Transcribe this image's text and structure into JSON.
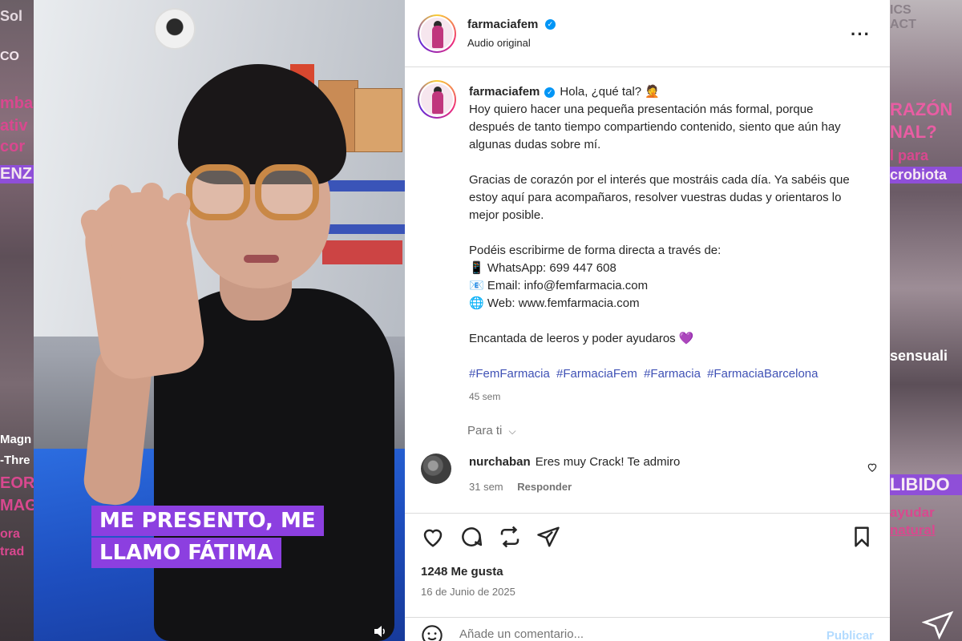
{
  "background": {
    "left_snippets": [
      "Sol",
      "CO",
      "mba",
      "ativ",
      "cor",
      "ENZ",
      "Magn",
      "-Thre",
      "EOR",
      "MAG",
      "ora",
      "trad"
    ],
    "right_snippets": [
      "ICS",
      "ACT",
      "RAZÓN",
      "NAL?",
      "l para",
      "crobiota",
      "sensuali",
      "LIBIDO",
      "ayudar",
      "natural"
    ]
  },
  "video": {
    "caption_line1": "ME PRESENTO, ME",
    "caption_line2": "LLAMO FÁTIMA",
    "caption_color": "#8c3fe0"
  },
  "header": {
    "username": "farmaciafem",
    "subtitle": "Audio original"
  },
  "post": {
    "username": "farmaciafem",
    "greeting": "Hola, ¿qué tal? 🤦",
    "paragraph1": "Hoy quiero hacer una pequeña presentación más formal, porque después de tanto tiempo compartiendo contenido, siento que aún hay algunas dudas sobre mí.",
    "paragraph2": "Gracias de corazón por el interés que mostráis cada día. Ya sabéis que estoy aquí para acompañaros, resolver vuestras dudas y orientaros lo mejor posible.",
    "paragraph3": "Podéis escribirme de forma directa a través de:",
    "contact_whatsapp": "📱 WhatsApp: 699 447 608",
    "contact_email": "📧 Email: info@femfarmacia.com",
    "contact_web": "🌐 Web: www.femfarmacia.com",
    "closing": "Encantada de leeros y poder ayudaros 💜",
    "hashtags": [
      "#FemFarmacia",
      "#FarmaciaFem",
      "#Farmacia",
      "#FarmaciaBarcelona"
    ],
    "time": "45 sem"
  },
  "filter": {
    "label": "Para ti",
    "chevron": "chevron-down-icon"
  },
  "comment": {
    "username": "nurchaban",
    "text": "Eres muy Crack! Te admiro",
    "time": "31 sem",
    "reply": "Responder"
  },
  "actions": {
    "likes": "1248 Me gusta",
    "date": "16 de Junio de 2025"
  },
  "comment_bar": {
    "placeholder": "Añade un comentario...",
    "publish": "Publicar"
  },
  "colors": {
    "accent": "#0095f6",
    "hashtag": "#3f51b5",
    "caption_bg": "#8c3fe0"
  }
}
